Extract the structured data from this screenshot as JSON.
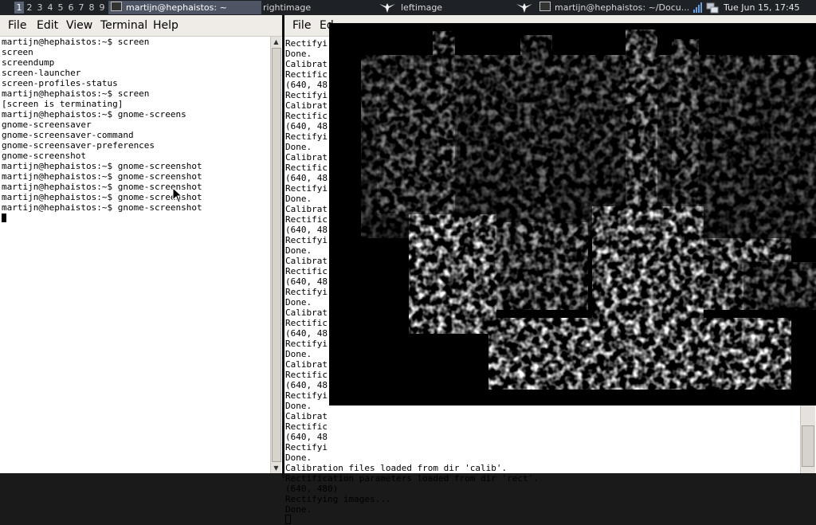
{
  "taskbar": {
    "workspaces": [
      "1",
      "2",
      "3",
      "4",
      "5",
      "6",
      "7",
      "8",
      "9"
    ],
    "tasks": [
      {
        "title": "martijn@hephaistos: ~"
      },
      {
        "title": "rightimage"
      },
      {
        "title": "leftimage"
      },
      {
        "title": "martijn@hephaistos: ~/Docu..."
      }
    ],
    "clock": "Tue Jun 15, 17:45"
  },
  "left_terminal": {
    "menu": {
      "file": "File",
      "edit": "Edit",
      "view": "View",
      "terminal": "Terminal",
      "help": "Help"
    },
    "lines": [
      "martijn@hephaistos:~$ screen",
      "screen",
      "screendump",
      "screen-launcher",
      "screen-profiles-status",
      "martijn@hephaistos:~$ screen",
      "[screen is terminating]",
      "martijn@hephaistos:~$ gnome-screens",
      "gnome-screensaver",
      "gnome-screensaver-command",
      "gnome-screensaver-preferences",
      "gnome-screenshot",
      "martijn@hephaistos:~$ gnome-screenshot",
      "martijn@hephaistos:~$ gnome-screenshot",
      "martijn@hephaistos:~$ gnome-screenshot",
      "martijn@hephaistos:~$ gnome-screenshot",
      "martijn@hephaistos:~$ gnome-screenshot"
    ]
  },
  "right_terminal": {
    "menu": {
      "file": "File",
      "edit": "Ed"
    },
    "lines": [
      "Rectifyi",
      "Done.",
      "Calibrat",
      "Rectific",
      "(640, 48",
      "Rectifyi",
      "Calibrat",
      "Rectific",
      "(640, 48",
      "Rectifyi",
      "Done.",
      "Calibrat",
      "Rectific",
      "(640, 48",
      "Rectifyi",
      "Done.",
      "Calibrat",
      "Rectific",
      "(640, 48",
      "Rectifyi",
      "Done.",
      "Calibrat",
      "Rectific",
      "(640, 48",
      "Rectifyi",
      "Done.",
      "Calibrat",
      "Rectific",
      "(640, 48",
      "Rectifyi",
      "Done.",
      "Calibrat",
      "Rectific",
      "(640, 48",
      "Rectifyi",
      "Done.",
      "Calibrat",
      "Rectific",
      "(640, 48",
      "Rectifyi",
      "Done.",
      "Calibration files loaded from dir 'calib'.",
      "Rectification parameters loaded from dir 'rect'.",
      "(640, 480)",
      "Rectifying images...",
      "Done."
    ]
  },
  "image_window": {
    "title": "leftimage"
  },
  "colors": {
    "taskbar_bg": "#1e2126",
    "menubar_bg": "#efebe7",
    "terminal_bg": "#ffffff"
  }
}
